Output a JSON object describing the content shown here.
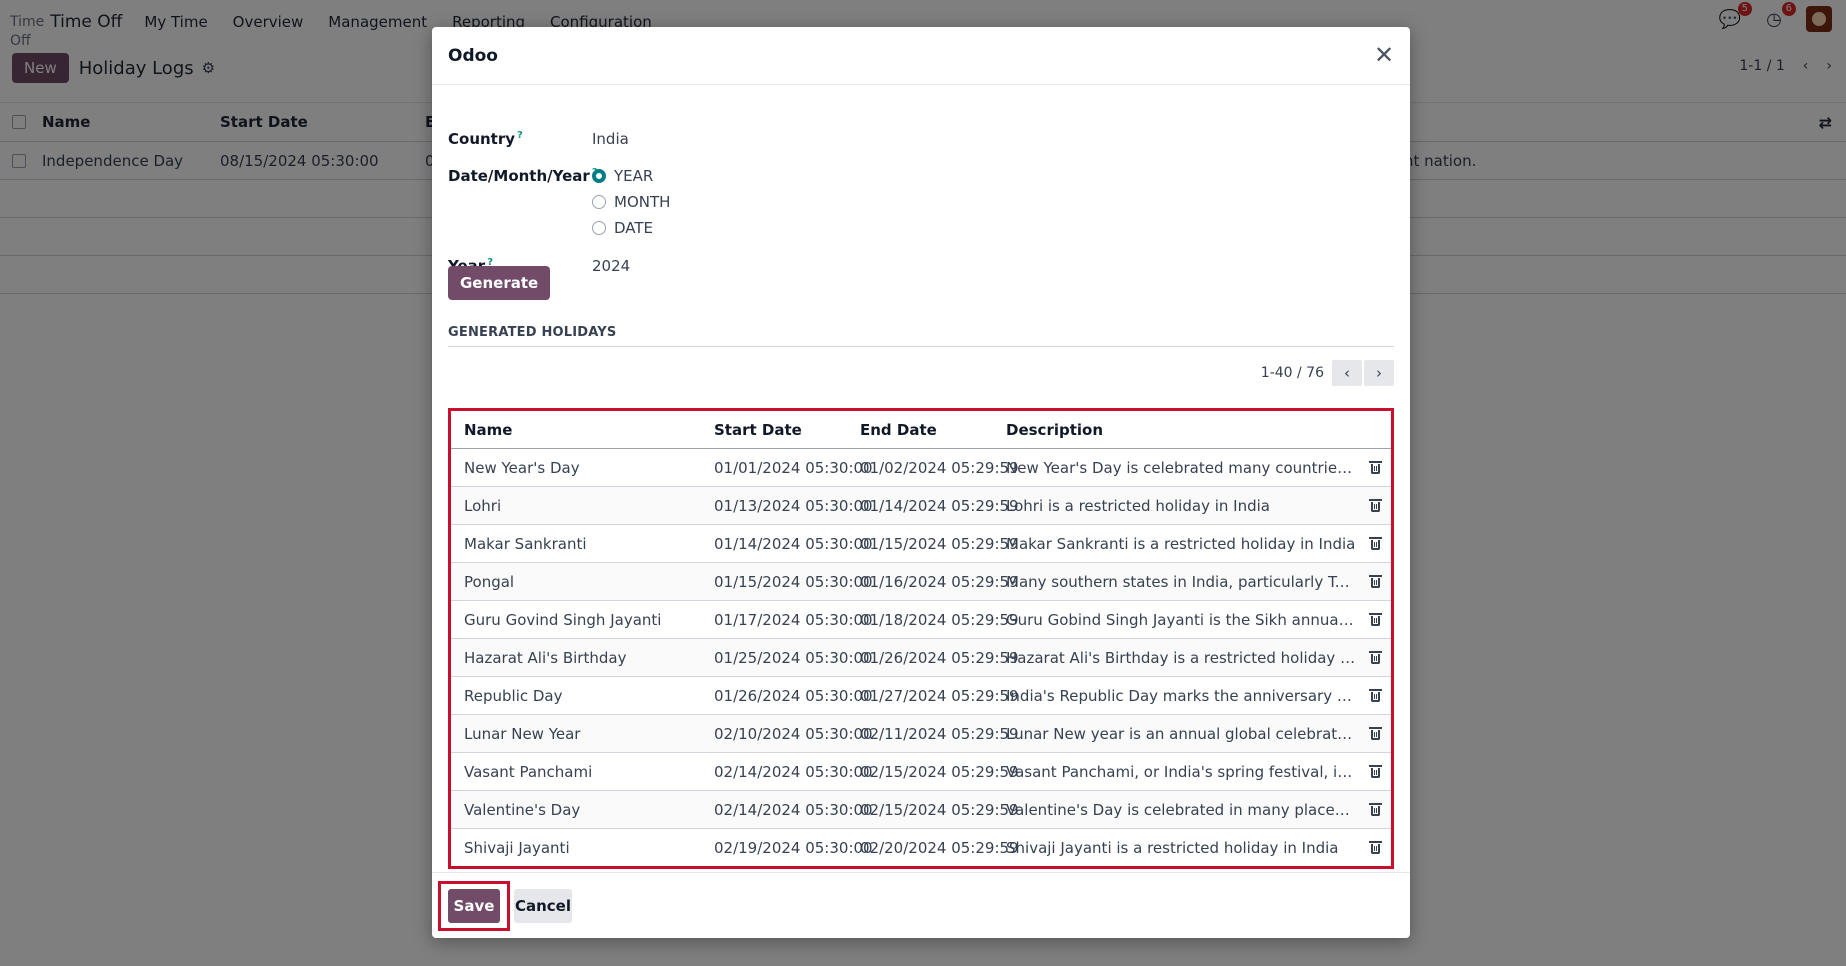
{
  "app": {
    "brand_small": "Time",
    "brand_small_off": "Off",
    "brand": "Time Off",
    "menu": [
      "My Time",
      "Overview",
      "Management",
      "Reporting",
      "Configuration"
    ],
    "chat_badge": "5",
    "activity_badge": "6"
  },
  "control": {
    "new_label": "New",
    "page_title": "Holiday Logs",
    "pager": "1-1 / 1"
  },
  "list": {
    "headers": {
      "name": "Name",
      "start": "Start Date",
      "e": "E"
    },
    "row": {
      "name": "Independence Day",
      "start": "08/15/2024 05:30:00",
      "e": "0",
      "desc": "nt nation."
    }
  },
  "modal": {
    "title": "Odoo",
    "country_label": "Country",
    "country_value": "India",
    "dmy_label": "Date/Month/Year",
    "radio_options": [
      "YEAR",
      "MONTH",
      "DATE"
    ],
    "radio_selected": "YEAR",
    "year_label": "Year",
    "year_value": "2024",
    "help_mark": "?",
    "generate_label": "Generate",
    "section_title": "GENERATED HOLIDAYS",
    "pager": "1-40 / 76",
    "table_headers": {
      "name": "Name",
      "start": "Start Date",
      "end": "End Date",
      "desc": "Description"
    },
    "rows": [
      {
        "name": "New Year's Day",
        "start": "01/01/2024 05:30:00",
        "end": "01/02/2024 05:29:59",
        "desc": "New Year's Day is celebrated many countries such as ..."
      },
      {
        "name": "Lohri",
        "start": "01/13/2024 05:30:00",
        "end": "01/14/2024 05:29:59",
        "desc": "Lohri is a restricted holiday in India"
      },
      {
        "name": "Makar Sankranti",
        "start": "01/14/2024 05:30:00",
        "end": "01/15/2024 05:29:59",
        "desc": "Makar Sankranti is a restricted holiday in India"
      },
      {
        "name": "Pongal",
        "start": "01/15/2024 05:30:00",
        "end": "01/16/2024 05:29:59",
        "desc": "Many southern states in India, particularly Tamil Nad..."
      },
      {
        "name": "Guru Govind Singh Jayanti",
        "start": "01/17/2024 05:30:00",
        "end": "01/18/2024 05:29:59",
        "desc": "Guru Gobind Singh Jayanti is the Sikh annual celebrat..."
      },
      {
        "name": "Hazarat Ali's Birthday",
        "start": "01/25/2024 05:30:00",
        "end": "01/26/2024 05:29:59",
        "desc": "Hazarat Ali's Birthday is a restricted holiday in India"
      },
      {
        "name": "Republic Day",
        "start": "01/26/2024 05:30:00",
        "end": "01/27/2024 05:29:59",
        "desc": "India's Republic Day marks the anniversary of the ado..."
      },
      {
        "name": "Lunar New Year",
        "start": "02/10/2024 05:30:00",
        "end": "02/11/2024 05:29:59",
        "desc": "Lunar New year is an annual global celebration in ma..."
      },
      {
        "name": "Vasant Panchami",
        "start": "02/14/2024 05:30:00",
        "end": "02/15/2024 05:29:59",
        "desc": "Vasant Panchami, or India's spring festival, is a Hindu ..."
      },
      {
        "name": "Valentine's Day",
        "start": "02/14/2024 05:30:00",
        "end": "02/15/2024 05:29:59",
        "desc": "Valentine's Day is celebrated in many places worldwi..."
      },
      {
        "name": "Shivaji Jayanti",
        "start": "02/19/2024 05:30:00",
        "end": "02/20/2024 05:29:59",
        "desc": "Shivaji Jayanti is a restricted holiday in India"
      }
    ],
    "save_label": "Save",
    "cancel_label": "Cancel"
  },
  "colors": {
    "brand": "#714b67",
    "highlight": "#c8102e",
    "radio_checked": "#017e84"
  },
  "icons": [
    "chat-icon",
    "clock-icon",
    "gear-icon",
    "close-icon",
    "chevron-left-icon",
    "chevron-right-icon",
    "trash-icon",
    "settings-toggle-icon"
  ]
}
